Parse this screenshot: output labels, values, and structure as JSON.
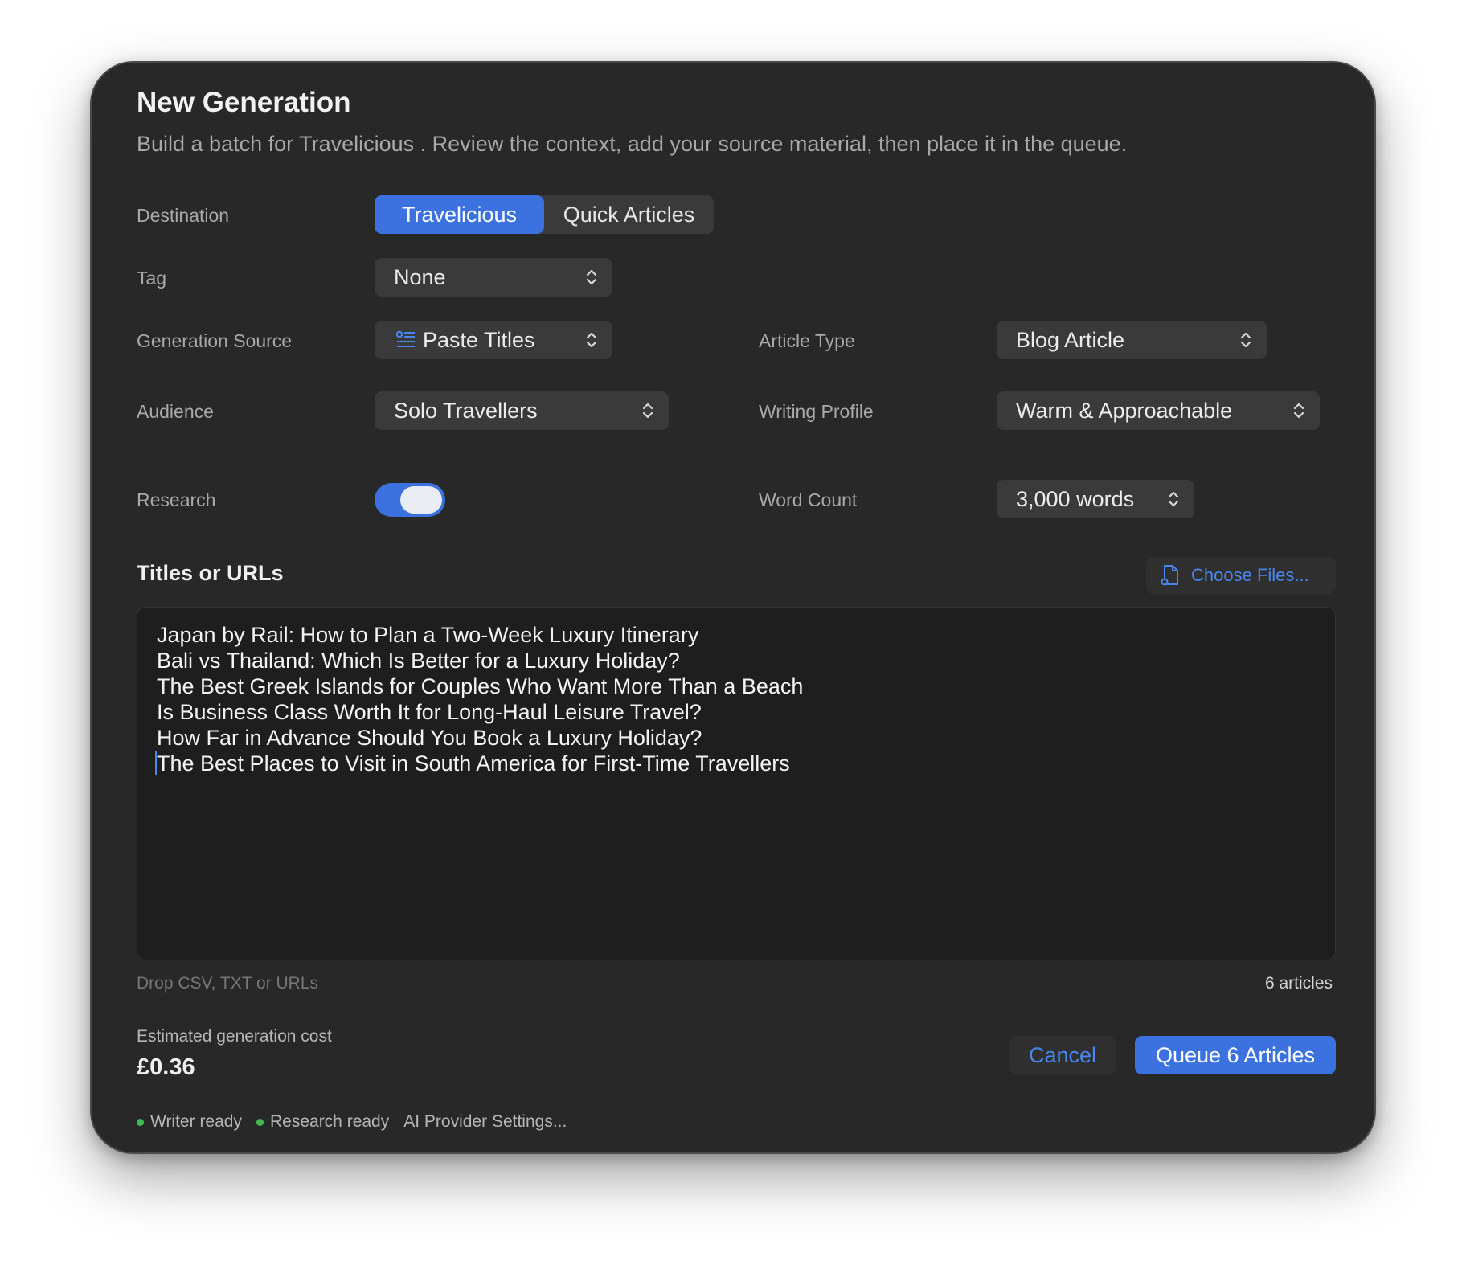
{
  "dialog": {
    "title": "New Generation",
    "subtitle": "Build a batch for Travelicious . Review the context, add your source material, then place it in the queue."
  },
  "form": {
    "destination": {
      "label": "Destination",
      "options": [
        "Travelicious",
        "Quick Articles"
      ],
      "selected": "Travelicious"
    },
    "tag": {
      "label": "Tag",
      "value": "None"
    },
    "generation_source": {
      "label": "Generation Source",
      "value": "Paste Titles",
      "icon": "list-icon"
    },
    "article_type": {
      "label": "Article Type",
      "value": "Blog Article"
    },
    "audience": {
      "label": "Audience",
      "value": "Solo Travellers"
    },
    "writing_profile": {
      "label": "Writing Profile",
      "value": "Warm & Approachable"
    },
    "research": {
      "label": "Research",
      "enabled": true
    },
    "word_count": {
      "label": "Word Count",
      "value": "3,000 words"
    }
  },
  "titles": {
    "section_title": "Titles or URLs",
    "choose_files_label": "Choose Files...",
    "choose_files_icon": "document-icon",
    "lines": [
      "Japan by Rail: How to Plan a Two-Week Luxury Itinerary",
      "Bali vs Thailand: Which Is Better for a Luxury Holiday?",
      "The Best Greek Islands for Couples Who Want More Than a Beach",
      "Is Business Class Worth It for Long-Haul Leisure Travel?",
      "How Far in Advance Should You Book a Luxury Holiday?",
      "The Best Places to Visit in South America for First-Time Travellers"
    ],
    "hint": "Drop CSV, TXT or URLs",
    "count": "6 articles"
  },
  "footer": {
    "cost_label": "Estimated generation cost",
    "cost_value": "£0.36",
    "cancel_label": "Cancel",
    "queue_label": "Queue 6 Articles",
    "status": [
      {
        "label": "Writer ready",
        "color": "#3fb950"
      },
      {
        "label": "Research ready",
        "color": "#3fb950"
      }
    ],
    "provider_settings_label": "AI Provider Settings..."
  },
  "colors": {
    "accent": "#3b72e0",
    "link": "#4a86f0",
    "window_bg": "#282828",
    "field_bg": "#3a3a3a",
    "ready": "#3fb950"
  }
}
